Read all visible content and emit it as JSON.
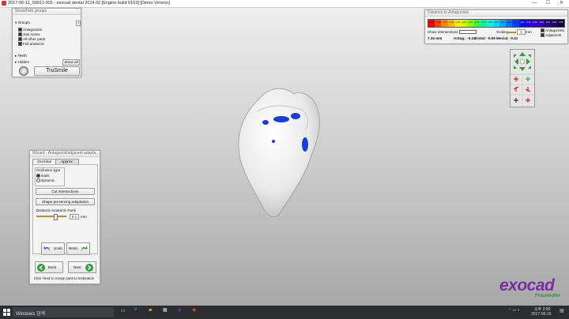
{
  "window": {
    "title": "2017-06-11_00011-005 - exocad dental 2014.02 [Engine build 5163] [Demo Version]",
    "minimize": "—",
    "maximize": "☐",
    "close": "✕"
  },
  "showhide": {
    "title": "Show/hide groups",
    "groups_label": "Groups",
    "help": "?",
    "items": [
      "Antagonists",
      "Jaw scans",
      "All other parts",
      "Full anatomic"
    ],
    "teeth_label": "Teeth",
    "hidden_label": "Hidden",
    "show_all": "Show all",
    "trusmile": "TruSmile"
  },
  "distance": {
    "title": "Distance to Antagonists",
    "scale_ticks": [
      "-0.45",
      "-0.41",
      "-0.37",
      "-0.33",
      "-0.29",
      "-0.25",
      "-0.21",
      "-0.17",
      "-0.13",
      "-0.09",
      "-0.05",
      "-0.01",
      "0.03",
      "0.07",
      "0.11",
      "0.15",
      "0.19",
      "0.23",
      "0.27",
      "0.31",
      "0.35"
    ],
    "show_intersections": "Show intersections",
    "scaling_label": "Scaling",
    "scaling_value": "1",
    "unit": "mm",
    "antagonists": "Antagonists",
    "adjacents": "Adjacents",
    "mm_value": "7.34 mm",
    "antag": "Antag.: -0.24",
    "distal": "Distal: -0.99",
    "mesial": "Mesial: -0.21"
  },
  "wizard": {
    "title": "Wizard - Antagonist/adjacent adapta...",
    "tab_occlusal": "Occlusal",
    "tab_approx": "Approx.",
    "occlusion_type": "Occlusion type",
    "static": "static",
    "dynamic": "dynamic",
    "cut_intersections": "Cut intersections",
    "shape_preserving": "Shape-preserving adaptation",
    "distance_label": "Distance Anatomic Parts",
    "distance_value": "0.1",
    "distance_unit": "mm",
    "undo": "Undo",
    "redo": "Redo",
    "back": "Back",
    "next": "Next",
    "hint": "Click 'Next' to merge parts to restoration"
  },
  "branding": {
    "logo": "exocad",
    "sub": "Fraunhofer"
  },
  "taskbar": {
    "search": "Windows 검색",
    "time": "오후 3:00",
    "date": "2017-06-15"
  },
  "colors": {
    "scale": [
      "#ff0000",
      "#ff4400",
      "#ff8800",
      "#ffbb00",
      "#ffee00",
      "#ccff00",
      "#88ff00",
      "#33ff44",
      "#00ff99",
      "#00ffdd",
      "#00ddff",
      "#00aaff",
      "#0077ff",
      "#0044ff",
      "#0011ff",
      "#2200ee",
      "#3300cc",
      "#3300aa",
      "#220088",
      "#220066",
      "#110044"
    ],
    "logo": "#7a2ba6",
    "contact_blue": "#1a3cd8"
  }
}
